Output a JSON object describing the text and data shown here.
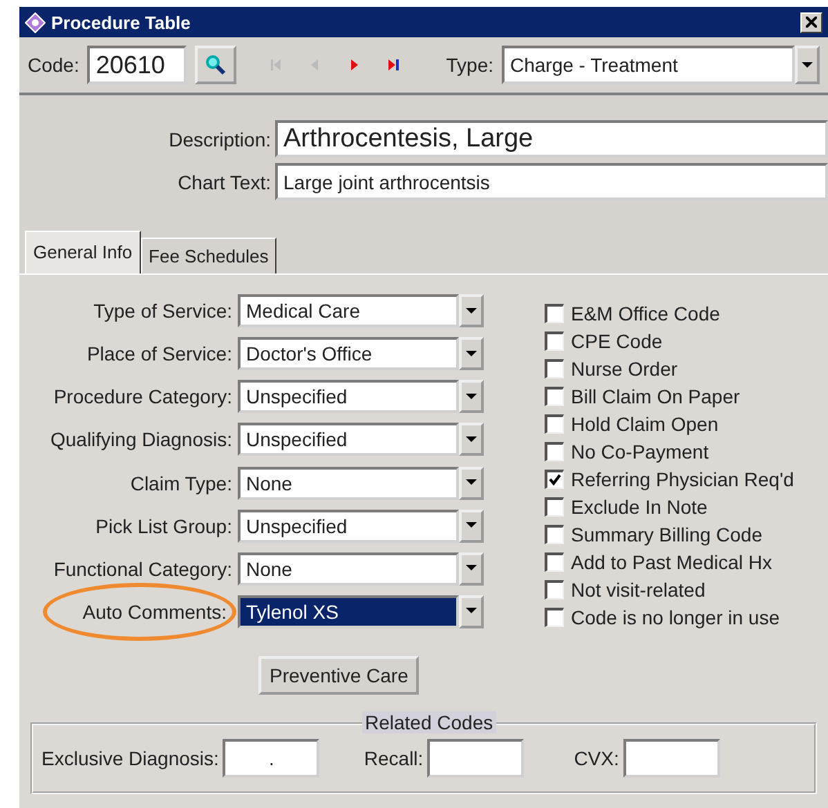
{
  "window": {
    "title": "Procedure Table"
  },
  "toolbar": {
    "code_label": "Code:",
    "code_value": "20610",
    "type_label": "Type:",
    "type_value": "Charge - Treatment"
  },
  "description": {
    "label": "Description:",
    "value": "Arthrocentesis, Large"
  },
  "chart_text": {
    "label": "Chart Text:",
    "value": "Large joint arthrocentsis"
  },
  "tabs": [
    {
      "label": "General Info",
      "selected": true
    },
    {
      "label": "Fee Schedules",
      "selected": false
    }
  ],
  "fields": [
    {
      "label": "Type of Service:",
      "value": "Medical Care",
      "selected": false
    },
    {
      "label": "Place of Service:",
      "value": "Doctor's Office",
      "selected": false
    },
    {
      "label": "Procedure Category:",
      "value": "Unspecified",
      "selected": false
    },
    {
      "label": "Qualifying Diagnosis:",
      "value": "Unspecified",
      "selected": false
    },
    {
      "label": "Claim Type:",
      "value": "None",
      "selected": false
    },
    {
      "label": "Pick List Group:",
      "value": "Unspecified",
      "selected": false
    },
    {
      "label": "Functional Category:",
      "value": "None",
      "selected": false
    },
    {
      "label": "Auto Comments:",
      "value": "Tylenol XS",
      "selected": true,
      "circled": true
    }
  ],
  "checkboxes": [
    {
      "label": "E&M Office Code",
      "checked": false
    },
    {
      "label": "CPE Code",
      "checked": false
    },
    {
      "label": "Nurse Order",
      "checked": false
    },
    {
      "label": "Bill Claim On Paper",
      "checked": false
    },
    {
      "label": "Hold Claim Open",
      "checked": false
    },
    {
      "label": "No Co-Payment",
      "checked": false
    },
    {
      "label": "Referring Physician Req'd",
      "checked": true
    },
    {
      "label": "Exclude In Note",
      "checked": false
    },
    {
      "label": "Summary Billing Code",
      "checked": false
    },
    {
      "label": "Add to Past Medical Hx",
      "checked": false
    },
    {
      "label": "Not visit-related",
      "checked": false
    },
    {
      "label": "Code is no longer in use",
      "checked": false
    }
  ],
  "preventive_button": "Preventive Care",
  "related_codes": {
    "title": "Related Codes",
    "fields": [
      {
        "label": "Exclusive Diagnosis:",
        "value": "."
      },
      {
        "label": "Recall:"
      },
      {
        "label": "CVX:"
      }
    ]
  }
}
